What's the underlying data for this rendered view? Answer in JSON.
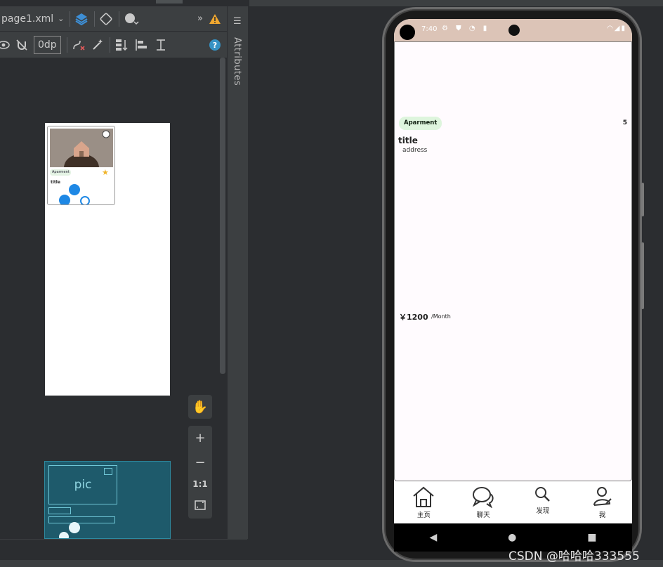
{
  "editor": {
    "file_tab": "page1.xml",
    "dp_value": "0dp",
    "sidebar_label": "Attributes",
    "zoom_actual": "1:1",
    "blueprint_label": "pic"
  },
  "mini_card": {
    "tag": "Aparment",
    "title": "title"
  },
  "phone": {
    "status_time": "7:40",
    "card": {
      "tag": "Aparment",
      "rating": "5",
      "title": "title",
      "address": "address",
      "price": "￥1200",
      "per": "/Month"
    },
    "bottom_nav": [
      {
        "label": "主页",
        "icon": "home-icon"
      },
      {
        "label": "聊天",
        "icon": "chat-icon"
      },
      {
        "label": "发现",
        "icon": "search-icon"
      },
      {
        "label": "我",
        "icon": "person-icon"
      }
    ]
  },
  "watermark": "CSDN @哈哈哈333555",
  "colors": {
    "ide_bg": "#2b2d30",
    "toolbar_bg": "#3c3f41",
    "chip_bg": "#def5dd",
    "status_bar": "#dcc4b7",
    "blueprint_bg": "#1e5a6b"
  }
}
